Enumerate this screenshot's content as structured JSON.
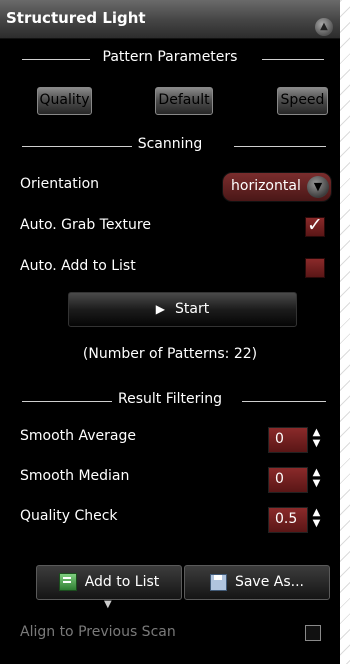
{
  "panel": {
    "title": "Structured Light",
    "collapse_icon": "chevron-up-icon"
  },
  "pattern_parameters": {
    "heading": "Pattern Parameters",
    "buttons": [
      "Quality",
      "Default",
      "Speed"
    ]
  },
  "scanning": {
    "heading": "Scanning",
    "orientation_label": "Orientation",
    "orientation_value": "horizontal",
    "auto_grab_label": "Auto. Grab Texture",
    "auto_grab_checked": true,
    "auto_add_label": "Auto. Add to List",
    "auto_add_checked": false,
    "start_label": "Start",
    "patterns_text": "(Number of Patterns: 22)"
  },
  "result_filtering": {
    "heading": "Result Filtering",
    "rows": [
      {
        "label": "Smooth Average",
        "value": "0"
      },
      {
        "label": "Smooth Median",
        "value": "0"
      },
      {
        "label": "Quality Check",
        "value": "0.5"
      }
    ]
  },
  "actions": {
    "add_to_list": "Add to List",
    "save_as": "Save As...",
    "align_label": "Align to Previous Scan",
    "align_checked": false
  },
  "colors": {
    "accent_red": "#6b2020",
    "background": "#000000"
  }
}
